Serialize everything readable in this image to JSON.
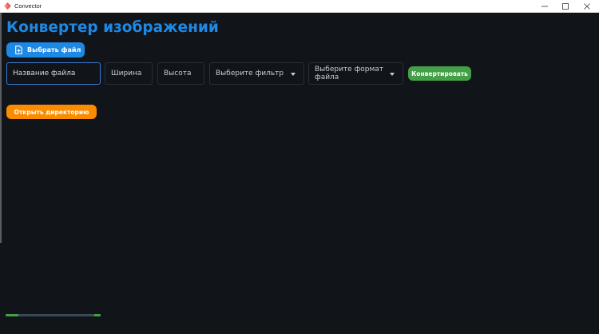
{
  "window": {
    "title": "Convector",
    "icons": {
      "app": "app-logo-icon",
      "minimize": "minimize-icon",
      "maximize": "maximize-icon",
      "close": "close-icon"
    }
  },
  "header": {
    "title": "Конвертер изображений"
  },
  "toolbar": {
    "pick_file_label": "Выбрать файл",
    "pick_file_icon": "file-add-icon",
    "accent": "#1e88e5"
  },
  "form": {
    "filename_placeholder": "Название файла",
    "width_placeholder": "Ширина",
    "height_placeholder": "Высота",
    "filter_select": "Выберите фильтр",
    "format_select": "Выберите формат файла",
    "convert_label": "Конвертировать",
    "convert_color": "#43a047"
  },
  "actions": {
    "open_dir_label": "Открыть директорию",
    "open_dir_color": "#fb8c00"
  },
  "progress": {
    "indeterminate": true
  }
}
